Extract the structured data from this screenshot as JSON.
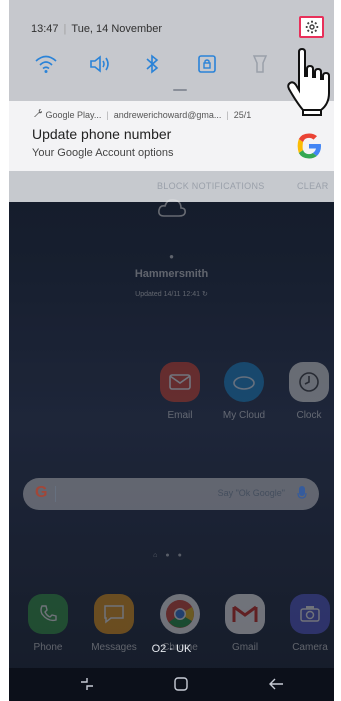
{
  "status_bar": {
    "time": "13:47",
    "date": "Tue, 14 November"
  },
  "quick_settings": [
    "wifi-icon",
    "sound-icon",
    "bluetooth-icon",
    "rotation-lock-icon",
    "flashlight-icon"
  ],
  "notification": {
    "app": "Google Play...",
    "account": "andrewerichoward@gma...",
    "time": "25/1",
    "title": "Update phone number",
    "body": "Your Google Account options"
  },
  "notification_actions": {
    "block": "BLOCK NOTIFICATIONS",
    "clear": "CLEAR"
  },
  "weather": {
    "city": "Hammersmith",
    "updated": "Updated 14/11 12:41"
  },
  "apps_row": [
    {
      "label": "Email",
      "color": "#e04a3a"
    },
    {
      "label": "My Cloud",
      "color": "#1e8fd6"
    },
    {
      "label": "Clock",
      "color": "#e8e8e8"
    }
  ],
  "search": {
    "placeholder": "Say \"Ok Google\""
  },
  "dock": [
    {
      "label": "Phone",
      "color": "#3aa04c"
    },
    {
      "label": "Messages",
      "color": "#f0a020"
    },
    {
      "label": "Chrome",
      "color": "#ffffff"
    },
    {
      "label": "Gmail",
      "color": "#ffffff"
    },
    {
      "label": "Camera",
      "color": "#5a5fd8"
    }
  ],
  "carrier": "O2 - UK",
  "colors": {
    "highlight": "#e8305a",
    "qs_icon": "#2a83d8"
  }
}
